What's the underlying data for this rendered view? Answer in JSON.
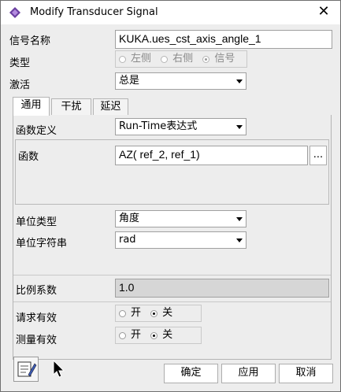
{
  "window": {
    "title": "Modify Transducer Signal",
    "close_glyph": "✕"
  },
  "signal_name": {
    "label": "信号名称",
    "value": "KUKA.ues_cst_axis_angle_1"
  },
  "type": {
    "label": "类型",
    "options": [
      "左侧",
      "右侧",
      "信号"
    ],
    "selected": "信号"
  },
  "activation": {
    "label": "激活",
    "value": "总是"
  },
  "tabs": [
    {
      "label": "通用"
    },
    {
      "label": "干扰"
    },
    {
      "label": "延迟"
    }
  ],
  "function_definition": {
    "label": "函数定义",
    "value": "Run-Time表达式"
  },
  "function": {
    "label": "函数",
    "value": "AZ(  ref_2, ref_1)",
    "browse_label": "..."
  },
  "unit_type": {
    "label": "单位类型",
    "value": "角度"
  },
  "unit_string": {
    "label": "单位字符串",
    "value": "rad"
  },
  "scale_factor": {
    "label": "比例系数",
    "value": "1.0"
  },
  "request_active": {
    "label": "请求有效",
    "options": [
      "开",
      "关"
    ],
    "selected": "关"
  },
  "measure_active": {
    "label": "测量有效",
    "options": [
      "开",
      "关"
    ],
    "selected": "关"
  },
  "buttons": {
    "ok": "确定",
    "apply": "应用",
    "cancel": "取消"
  },
  "icons": {
    "app": "adams-logo-icon",
    "edit": "edit-notepad-icon",
    "cursor": "mouse-cursor-icon"
  }
}
